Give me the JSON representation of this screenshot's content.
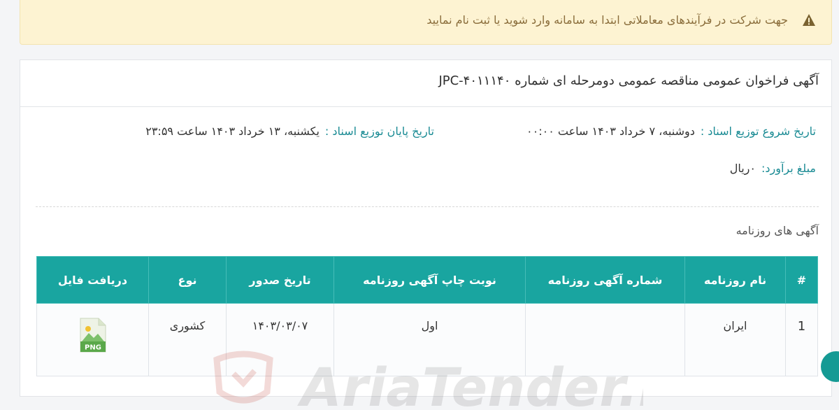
{
  "alert": {
    "text": "جهت شرکت در فرآیندهای معاملاتی ابتدا به سامانه وارد شوید یا ثبت نام نمایید",
    "icon": "warning-icon"
  },
  "notice": {
    "title": "آگهی فراخوان عمومی مناقصه عمومی دومرحله ای شماره JPC-۴۰۱۱۱۴۰",
    "start_label": "تاریخ شروع توزیع اسناد :",
    "start_value": "دوشنبه، ۷ خرداد ۱۴۰۳ ساعت ۰۰:۰۰",
    "end_label": "تاریخ پایان توزیع اسناد :",
    "end_value": "یکشنبه، ۱۳ خرداد ۱۴۰۳ ساعت ۲۳:۵۹",
    "amount_label": "مبلغ برآورد:",
    "amount_value": "۰ریال"
  },
  "newspaper": {
    "section_title": "آگهی های روزنامه",
    "headers": [
      "#",
      "نام روزنامه",
      "شماره آگهی روزنامه",
      "نوبت چاپ آگهی روزنامه",
      "تاریخ صدور",
      "نوع",
      "دریافت فایل"
    ],
    "rows": [
      {
        "idx": "1",
        "name": "ایران",
        "ad_number": "",
        "round": "اول",
        "issue_date": "۱۴۰۳/۰۳/۰۷",
        "type": "کشوری",
        "file_label": "PNG"
      }
    ]
  },
  "watermark": "AriaTender.neT",
  "colors": {
    "accent": "#19a5a0",
    "label": "#1a8b94",
    "alert_bg": "#fdf3d2",
    "alert_text": "#8a6d3b"
  }
}
